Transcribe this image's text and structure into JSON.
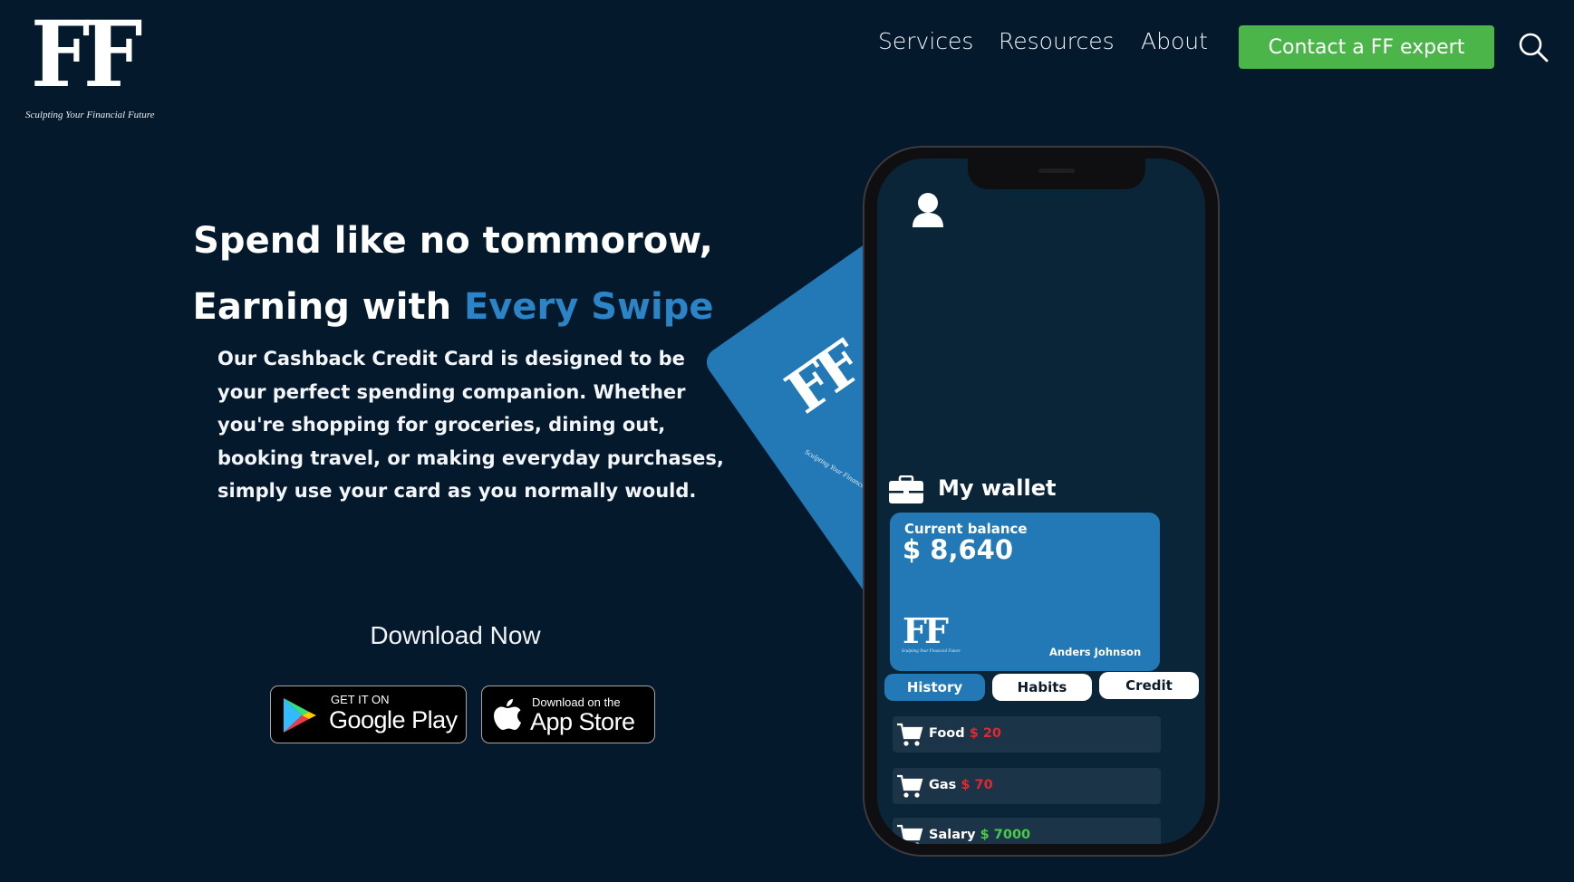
{
  "brand": {
    "logo_mark": "FF",
    "tagline": "Sculpting Your Financial Future"
  },
  "nav": {
    "items": [
      "Services",
      "Resources",
      "About"
    ],
    "cta_label": "Contact a FF expert"
  },
  "hero": {
    "headline_line1": "Spend like no tommorow,",
    "headline_line2_prefix": "Earning with ",
    "headline_line2_accent": "Every Swipe",
    "body": "Our Cashback Credit Card is designed to be your perfect spending companion. Whether you're shopping for groceries, dining out, booking travel, or making everyday purchases, simply use your card as you normally would.",
    "download_title": "Download Now",
    "google_play": {
      "small": "GET IT ON",
      "big": "Google Play"
    },
    "app_store": {
      "small": "Download on the",
      "big": "App Store"
    }
  },
  "phone": {
    "wallet_title": "My wallet",
    "balance_label": "Current balance",
    "balance_value": "$ 8,640",
    "card_logo": "FF",
    "card_tagline": "Sculpting Your Financial Future",
    "card_holder": "Anders Johnson",
    "tabs": [
      "History",
      "Habits",
      "Credit"
    ],
    "active_tab": "History",
    "transactions": [
      {
        "label": "Food",
        "amount": "$ 20",
        "type": "expense"
      },
      {
        "label": "Gas",
        "amount": "$ 70",
        "type": "expense"
      },
      {
        "label": "Salary",
        "amount": "$ 7000",
        "type": "income"
      }
    ]
  },
  "colors": {
    "background": "#05192c",
    "accent_blue": "#2a84c6",
    "cta_green": "#4bb54a",
    "card_blue": "#2279b5",
    "expense_red": "#e0282f",
    "income_green": "#4cc84a"
  }
}
